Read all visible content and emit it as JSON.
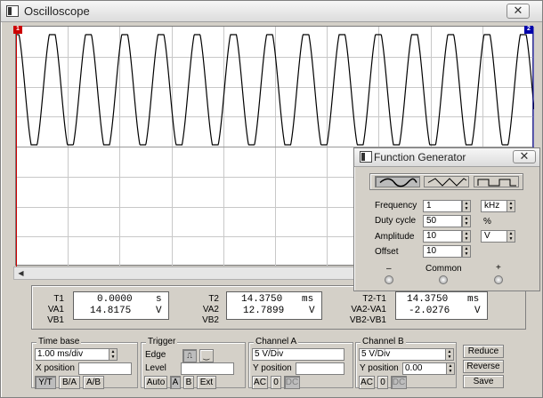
{
  "scope": {
    "title": "Oscilloscope",
    "close_label": "✕",
    "marker1": "1",
    "marker2": "2",
    "readouts": {
      "t1": {
        "label": "T1",
        "value": "0.0000",
        "unit": "s"
      },
      "va1": {
        "label": "VA1",
        "value": "14.8175",
        "unit": "V"
      },
      "vb1": {
        "label": "VB1"
      },
      "t2": {
        "label": "T2",
        "value": "14.3750",
        "unit": "ms"
      },
      "va2": {
        "label": "VA2",
        "value": "12.7899",
        "unit": "V"
      },
      "vb2": {
        "label": "VB2"
      },
      "t21": {
        "label": "T2-T1",
        "value": "14.3750",
        "unit": "ms"
      },
      "va21": {
        "label": "VA2-VA1",
        "value": "-2.0276",
        "unit": "V"
      },
      "vb21": {
        "label": "VB2-VB1"
      }
    },
    "timebase": {
      "title": "Time base",
      "value": "1.00 ms/div",
      "xpos_label": "X position",
      "yt": "Y/T",
      "ba": "B/A",
      "ab": "A/B"
    },
    "trigger": {
      "title": "Trigger",
      "edge_label": "Edge",
      "level_label": "Level",
      "auto": "Auto",
      "a": "A",
      "b": "B",
      "ext": "Ext"
    },
    "channel_a": {
      "title": "Channel A",
      "value": "5 V/Div",
      "ypos_label": "Y position",
      "ac": "AC",
      "zero": "0",
      "dc": "DC"
    },
    "channel_b": {
      "title": "Channel B",
      "value": "5 V/Div",
      "ypos_label": "Y position",
      "ypos_value": "0.00",
      "ac": "AC",
      "zero": "0",
      "dc": "DC"
    },
    "buttons": {
      "reduce": "Reduce",
      "reverse": "Reverse",
      "save": "Save"
    }
  },
  "function_generator": {
    "title": "Function Generator",
    "close_label": "✕",
    "waveforms": [
      {
        "name": "sine",
        "selected": true
      },
      {
        "name": "triangle",
        "selected": false
      },
      {
        "name": "square",
        "selected": false
      }
    ],
    "frequency": {
      "label": "Frequency",
      "value": "1",
      "unit": "kHz"
    },
    "duty_cycle": {
      "label": "Duty cycle",
      "value": "50",
      "unit": "%"
    },
    "amplitude": {
      "label": "Amplitude",
      "value": "10",
      "unit": "V"
    },
    "offset": {
      "label": "Offset",
      "value": "10"
    },
    "terminals": {
      "minus": "–",
      "common": "Common",
      "plus": "+"
    }
  },
  "colors": {
    "trace": "#000000",
    "grid": "#c8c8c8",
    "marker1": "#cc0000",
    "marker2": "#0000aa"
  }
}
